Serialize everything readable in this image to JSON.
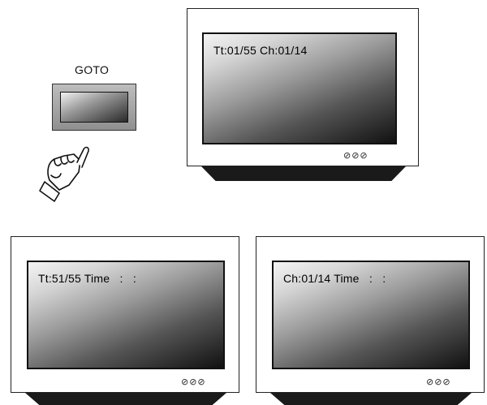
{
  "goto_button": {
    "label": "GOTO"
  },
  "monitors": {
    "top": {
      "screen_text": "Tt:01/55 Ch:01/14",
      "knobs": "⊘⊘⊘"
    },
    "bottom_left": {
      "screen_text": "Tt:51/55 Time   :   :",
      "knobs": "⊘⊘⊘"
    },
    "bottom_right": {
      "screen_text": "Ch:01/14 Time   :   :",
      "knobs": "⊘⊘⊘"
    }
  },
  "icons": {
    "hand": "pointing-hand-icon"
  }
}
